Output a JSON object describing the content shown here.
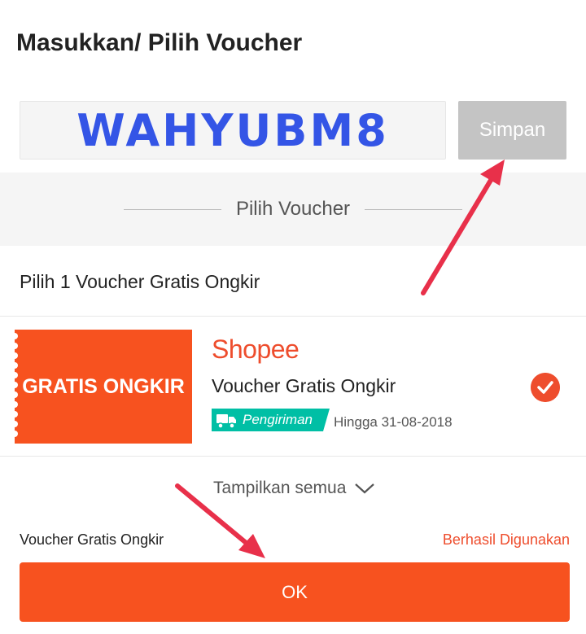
{
  "header": {
    "title": "Masukkan/ Pilih Voucher"
  },
  "code_entry": {
    "value": "WAHYUBM8",
    "save_label": "Simpan"
  },
  "section": {
    "label": "Pilih Voucher"
  },
  "group": {
    "title": "Pilih 1 Voucher Gratis Ongkir"
  },
  "voucher": {
    "badge_text": "GRATIS ONGKIR",
    "brand": "Shopee",
    "name": "Voucher Gratis Ongkir",
    "tag_label": "Pengiriman",
    "valid_until": "Hingga 31-08-2018",
    "selected": true
  },
  "show_all": {
    "label": "Tampilkan semua"
  },
  "footer": {
    "label": "Voucher Gratis Ongkir",
    "status": "Berhasil Digunakan",
    "ok_label": "OK"
  },
  "colors": {
    "accent": "#ee4d2d",
    "voucher_bg": "#f7521f",
    "tag": "#00bfa5",
    "code_text": "#3455e6",
    "arrow": "#e8304a"
  },
  "icons": [
    "truck-icon",
    "check-circle-icon",
    "chevron-down-icon"
  ]
}
